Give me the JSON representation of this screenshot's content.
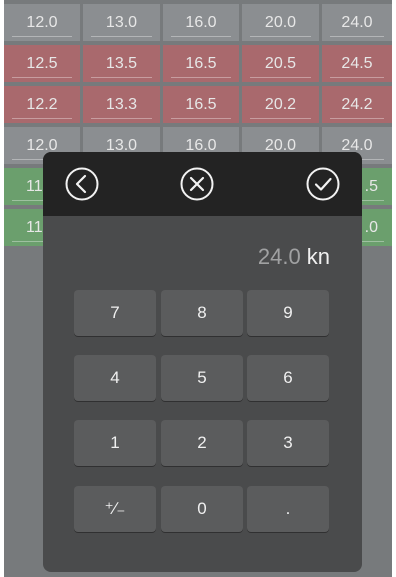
{
  "table": {
    "rows": [
      {
        "style": "gray",
        "cells": [
          "12.0",
          "13.0",
          "16.0",
          "20.0",
          "24.0"
        ]
      },
      {
        "style": "red",
        "cells": [
          "12.5",
          "13.5",
          "16.5",
          "20.5",
          "24.5"
        ]
      },
      {
        "style": "red",
        "cells": [
          "12.2",
          "13.3",
          "16.5",
          "20.2",
          "24.2"
        ]
      },
      {
        "style": "gray",
        "cells": [
          "12.0",
          "13.0",
          "16.0",
          "20.0",
          "24.0"
        ]
      },
      {
        "style": "green",
        "cells": [
          "11",
          "",
          "",
          "",
          ".5"
        ]
      },
      {
        "style": "green",
        "cells": [
          "11",
          "",
          "",
          "",
          ".0"
        ]
      }
    ]
  },
  "modal": {
    "header": {
      "back_icon": "chevron-left-circle-icon",
      "cancel_icon": "x-circle-icon",
      "confirm_icon": "check-circle-icon"
    },
    "display": {
      "value": "24.0",
      "unit": "kn"
    },
    "keys": [
      "7",
      "8",
      "9",
      "4",
      "5",
      "6",
      "1",
      "2",
      "3",
      "⁺∕₋",
      "0",
      "."
    ]
  },
  "colors": {
    "gray_cell": "#8b8e91",
    "red_cell": "#a9696d",
    "green_cell": "#6b9f6d",
    "modal_bg": "#4a4b4c",
    "header_bg": "#232323",
    "key_bg": "#5b5c5d"
  }
}
